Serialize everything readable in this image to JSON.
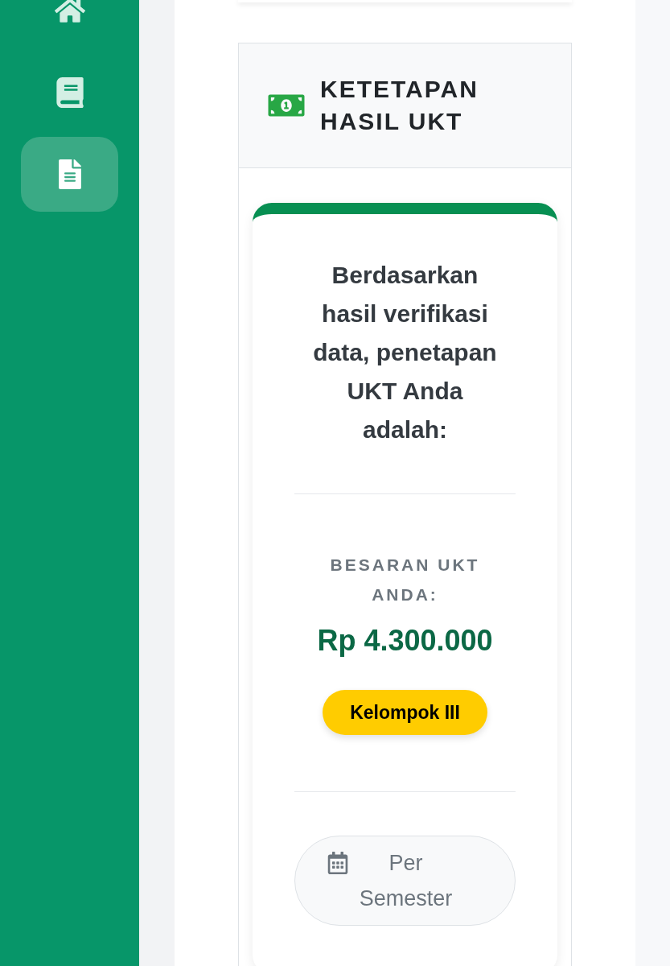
{
  "sidebar": {
    "items": [
      {
        "selected": false
      },
      {
        "selected": false
      },
      {
        "selected": true
      }
    ]
  },
  "card": {
    "title": "KETETAPAN HASIL UKT",
    "result": {
      "intro": "Berdasarkan hasil verifikasi data, penetapan UKT Anda adalah:",
      "amount_label": "BESARAN UKT ANDA:",
      "amount": "Rp 4.300.000",
      "group_badge": "Kelompok III",
      "period": "Per Semester"
    }
  }
}
